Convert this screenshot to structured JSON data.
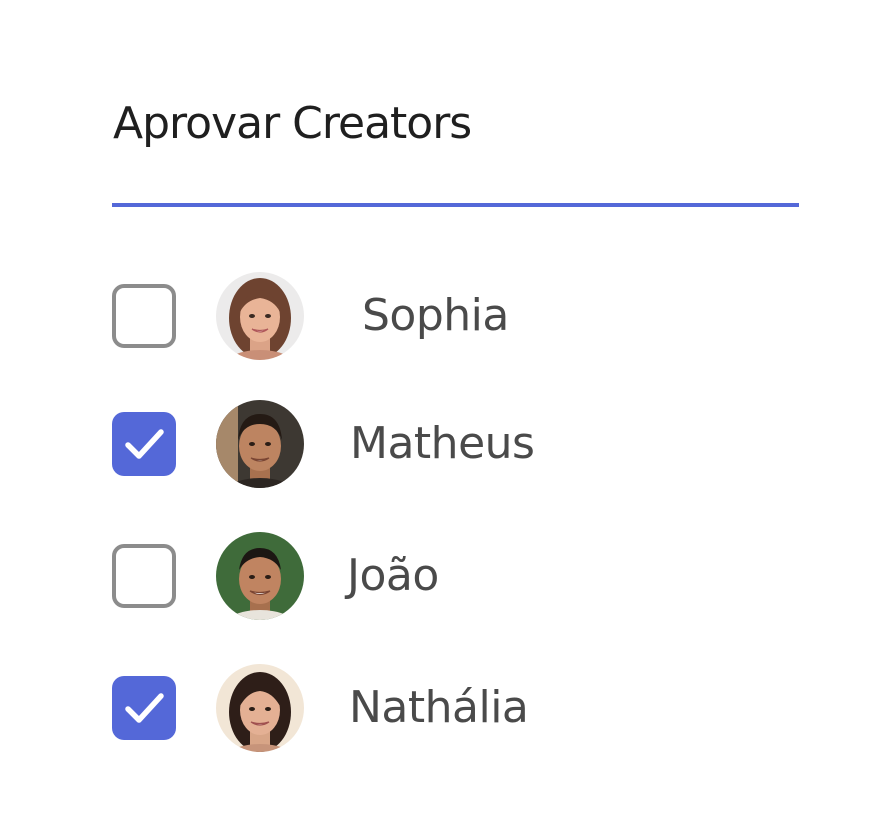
{
  "header": {
    "title": "Aprovar Creators"
  },
  "colors": {
    "accent": "#5468d8",
    "checkbox_border": "#8c8c8c",
    "text": "#4a4a4a"
  },
  "creators": [
    {
      "name": "Sophia",
      "checked": false,
      "avatar_icon": "woman-avatar-icon"
    },
    {
      "name": "Matheus",
      "checked": true,
      "avatar_icon": "man-avatar-icon"
    },
    {
      "name": "João",
      "checked": false,
      "avatar_icon": "man-avatar-icon"
    },
    {
      "name": "Nathália",
      "checked": true,
      "avatar_icon": "woman-avatar-icon"
    }
  ]
}
